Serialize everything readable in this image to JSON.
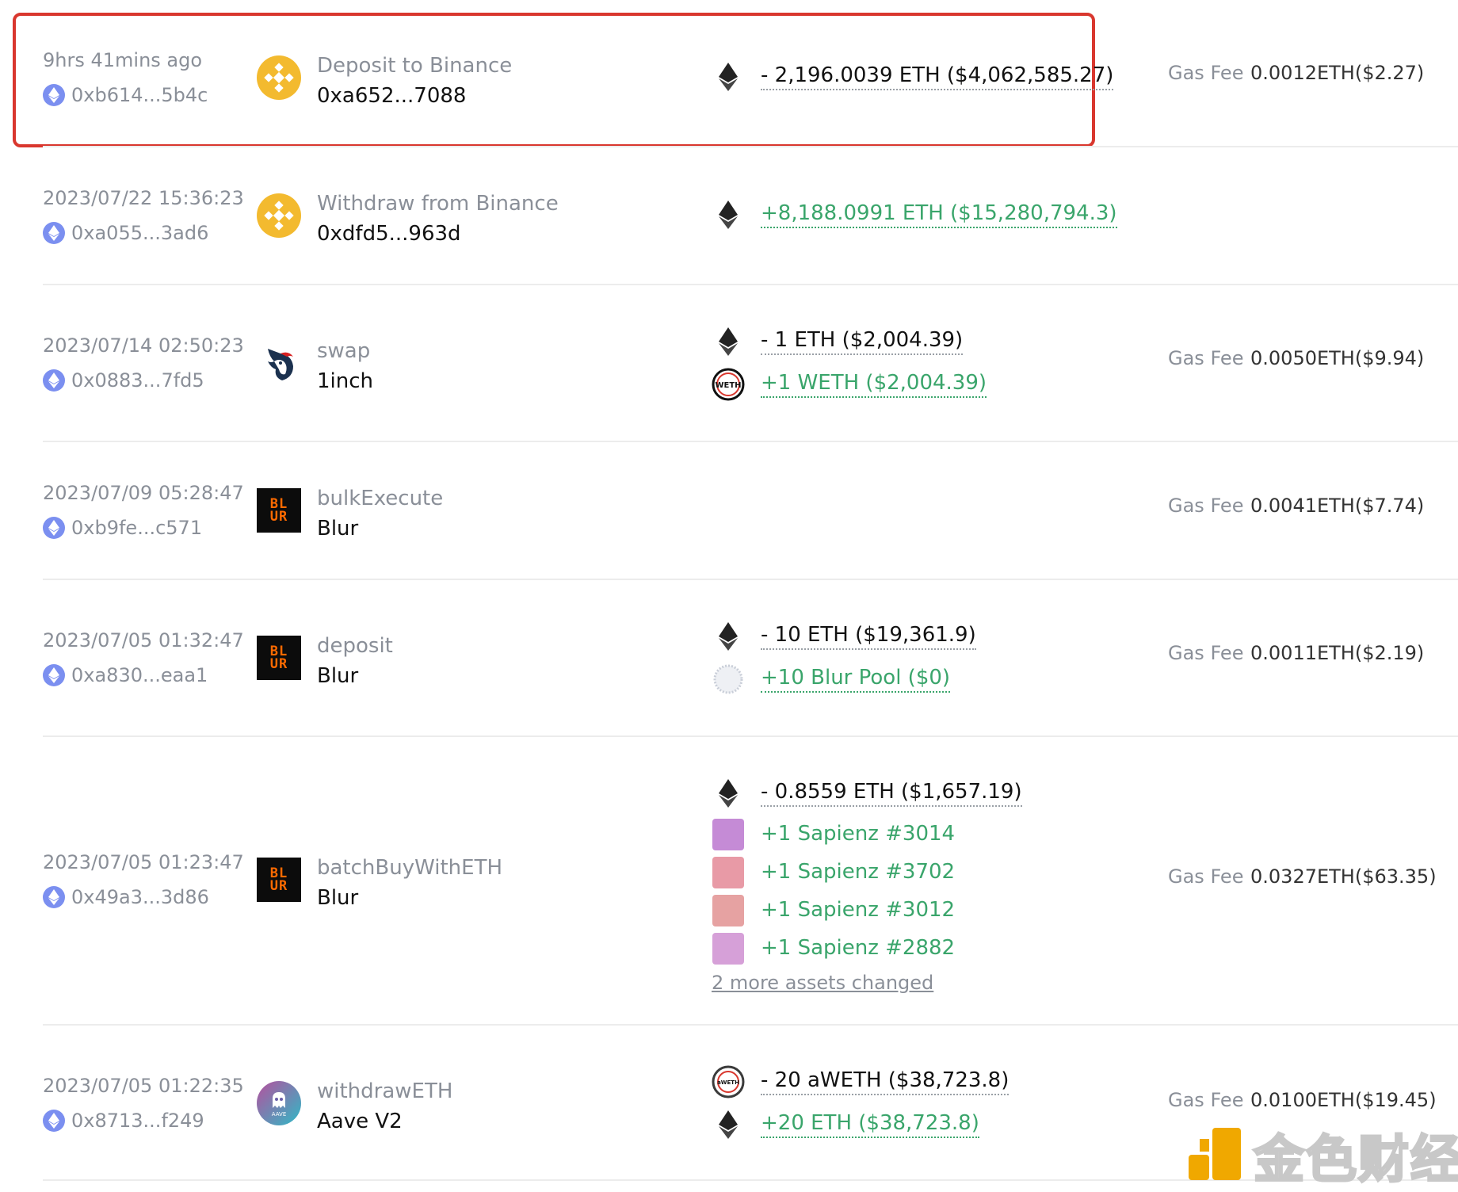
{
  "colors": {
    "positive": "#3aa56b",
    "negative": "#111111",
    "muted": "#8a8f98",
    "highlight": "#d9372e",
    "eth_badge": "#7b8ff0",
    "binance": "#f3ba2f",
    "blur": "#ff6a00"
  },
  "gas_label": "Gas Fee",
  "transactions": [
    {
      "time": "9hrs 41mins ago",
      "hash": "0xb614...5b4c",
      "method": "Deposit to Binance",
      "protocol": "0xa652...7088",
      "logo": "binance-logo",
      "assets": [
        {
          "icon": "eth-icon",
          "amount": "- 2,196.0039 ETH ($4,062,585.27)",
          "direction": "out"
        }
      ],
      "gas": "0.0012ETH($2.27)"
    },
    {
      "time": "2023/07/22 15:36:23",
      "hash": "0xa055...3ad6",
      "method": "Withdraw from Binance",
      "protocol": "0xdfd5...963d",
      "logo": "binance-logo",
      "assets": [
        {
          "icon": "eth-icon",
          "amount": "+8,188.0991 ETH ($15,280,794.3)",
          "direction": "in"
        }
      ],
      "gas": ""
    },
    {
      "time": "2023/07/14 02:50:23",
      "hash": "0x0883...7fd5",
      "method": "swap",
      "protocol": "1inch",
      "logo": "1inch-logo",
      "assets": [
        {
          "icon": "eth-icon",
          "amount": "- 1 ETH ($2,004.39)",
          "direction": "out"
        },
        {
          "icon": "weth-icon",
          "amount": "+1 WETH ($2,004.39)",
          "direction": "in"
        }
      ],
      "gas": "0.0050ETH($9.94)"
    },
    {
      "time": "2023/07/09 05:28:47",
      "hash": "0xb9fe...c571",
      "method": "bulkExecute",
      "protocol": "Blur",
      "logo": "blur-logo",
      "assets": [],
      "gas": "0.0041ETH($7.74)"
    },
    {
      "time": "2023/07/05 01:32:47",
      "hash": "0xa830...eaa1",
      "method": "deposit",
      "protocol": "Blur",
      "logo": "blur-logo",
      "assets": [
        {
          "icon": "eth-icon",
          "amount": "- 10 ETH ($19,361.9)",
          "direction": "out"
        },
        {
          "icon": "blur-pool-icon",
          "amount": "+10 Blur Pool ($0)",
          "direction": "in"
        }
      ],
      "gas": "0.0011ETH($2.19)"
    },
    {
      "time": "2023/07/05 01:23:47",
      "hash": "0x49a3...3d86",
      "method": "batchBuyWithETH",
      "protocol": "Blur",
      "logo": "blur-logo",
      "assets": [
        {
          "icon": "eth-icon",
          "amount": "- 0.8559 ETH ($1,657.19)",
          "direction": "out"
        },
        {
          "icon": "nft-icon",
          "amount": "+1 Sapienz #3014",
          "direction": "in",
          "nft_bg": "#c58bd6"
        },
        {
          "icon": "nft-icon",
          "amount": "+1 Sapienz #3702",
          "direction": "in",
          "nft_bg": "#e89aa6"
        },
        {
          "icon": "nft-icon",
          "amount": "+1 Sapienz #3012",
          "direction": "in",
          "nft_bg": "#e6a2a2"
        },
        {
          "icon": "nft-icon",
          "amount": "+1 Sapienz #2882",
          "direction": "in",
          "nft_bg": "#d6a0d8"
        }
      ],
      "more_link": "2 more assets changed",
      "gas": "0.0327ETH($63.35)"
    },
    {
      "time": "2023/07/05 01:22:35",
      "hash": "0x8713...f249",
      "method": "withdrawETH",
      "protocol": "Aave V2",
      "logo": "aave-logo",
      "assets": [
        {
          "icon": "aweth-icon",
          "amount": "- 20 aWETH ($38,723.8)",
          "direction": "out"
        },
        {
          "icon": "eth-icon",
          "amount": "+20 ETH ($38,723.8)",
          "direction": "in"
        }
      ],
      "gas": "0.0100ETH($19.45)"
    }
  ],
  "logo_text": {
    "blur": [
      "BL",
      "UR"
    ],
    "weth": "WETH",
    "aweth": "aWETH",
    "aave": "AAVE"
  },
  "watermark": {
    "text": "金色财经"
  }
}
